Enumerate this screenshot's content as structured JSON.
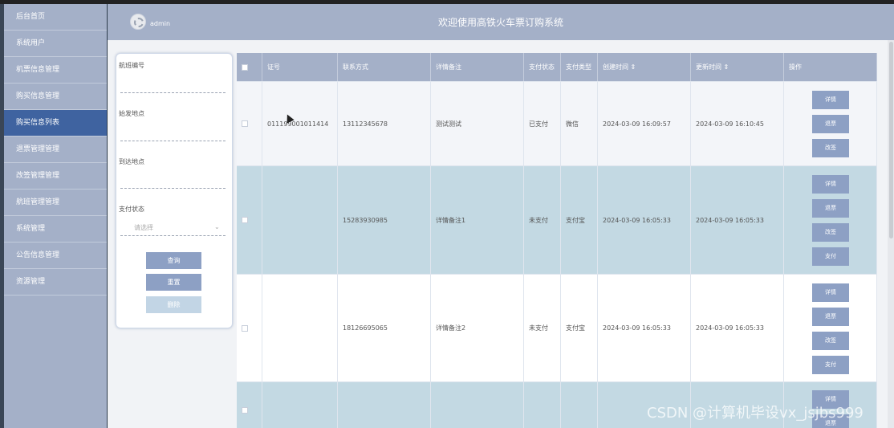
{
  "app": {
    "title": "欢迎使用高铁火车票订购系统",
    "username": "admin"
  },
  "sidebar": {
    "items": [
      {
        "label": "后台首页"
      },
      {
        "label": "系统用户"
      },
      {
        "label": "机票信息管理"
      },
      {
        "label": "购买信息管理"
      },
      {
        "label": "购买信息列表"
      },
      {
        "label": "退票管理管理"
      },
      {
        "label": "改签管理管理"
      },
      {
        "label": "航班管理管理"
      },
      {
        "label": "系统管理"
      },
      {
        "label": "公告信息管理"
      },
      {
        "label": "资源管理"
      }
    ],
    "active_index": 4
  },
  "filter": {
    "flight_no_label": "航班编号",
    "origin_label": "始发地点",
    "dest_label": "到达地点",
    "pay_status_label": "支付状态",
    "pay_status_placeholder": "请选择",
    "query_btn": "查询",
    "reset_btn": "重置",
    "delete_btn": "删除"
  },
  "table": {
    "headers": [
      "证号",
      "联系方式",
      "详情备注",
      "支付状态",
      "支付类型",
      "创建时间 ⇕",
      "更新时间 ⇕",
      "操作"
    ],
    "rows": [
      {
        "id": "011199001011414",
        "phone": "13112345678",
        "note": "测试测试",
        "status": "已支付",
        "type": "微信",
        "created": "2024-03-09 16:09:57",
        "updated": "2024-03-09 16:10:45",
        "actions": [
          "详情",
          "退票",
          "改签"
        ]
      },
      {
        "id": "",
        "phone": "15283930985",
        "note": "详情备注1",
        "status": "未支付",
        "type": "支付宝",
        "created": "2024-03-09 16:05:33",
        "updated": "2024-03-09 16:05:33",
        "actions": [
          "详情",
          "退票",
          "改签",
          "支付"
        ]
      },
      {
        "id": "",
        "phone": "18126695065",
        "note": "详情备注2",
        "status": "未支付",
        "type": "支付宝",
        "created": "2024-03-09 16:05:33",
        "updated": "2024-03-09 16:05:33",
        "actions": [
          "详情",
          "退票",
          "改签",
          "支付"
        ]
      },
      {
        "id": "",
        "phone": "",
        "note": "",
        "status": "",
        "type": "",
        "created": "",
        "updated": "",
        "actions": [
          "详情",
          "退票"
        ]
      }
    ]
  },
  "watermark": "CSDN @计算机毕设vx_jsjbs999"
}
